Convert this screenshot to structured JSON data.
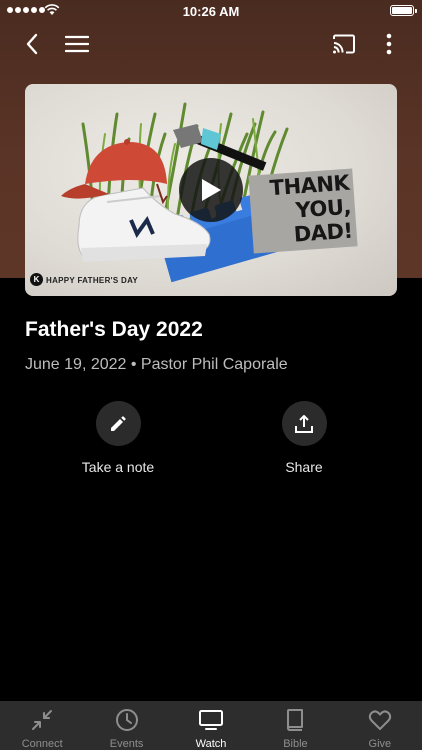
{
  "status_bar": {
    "time": "10:26 AM"
  },
  "video": {
    "thumbnail_text": [
      "THANK",
      "YOU,",
      "DAD!"
    ],
    "thumbnail_logo": "K",
    "thumbnail_caption": "HAPPY FATHER'S DAY"
  },
  "sermon": {
    "title": "Father's Day 2022",
    "meta": "June 19, 2022 • Pastor Phil Caporale"
  },
  "actions": [
    {
      "label": "Take a note",
      "icon": "pencil-icon"
    },
    {
      "label": "Share",
      "icon": "share-icon"
    }
  ],
  "tabs": [
    {
      "label": "Connect",
      "icon": "connect-arrows-icon",
      "active": false
    },
    {
      "label": "Events",
      "icon": "clock-icon",
      "active": false
    },
    {
      "label": "Watch",
      "icon": "tv-icon",
      "active": true
    },
    {
      "label": "Bible",
      "icon": "book-icon",
      "active": false
    },
    {
      "label": "Give",
      "icon": "heart-icon",
      "active": false
    }
  ],
  "colors": {
    "header_brown": "#5a3426",
    "background": "#000000",
    "tab_bar": "#2d2d2d",
    "action_circle": "#2b2b2b"
  }
}
